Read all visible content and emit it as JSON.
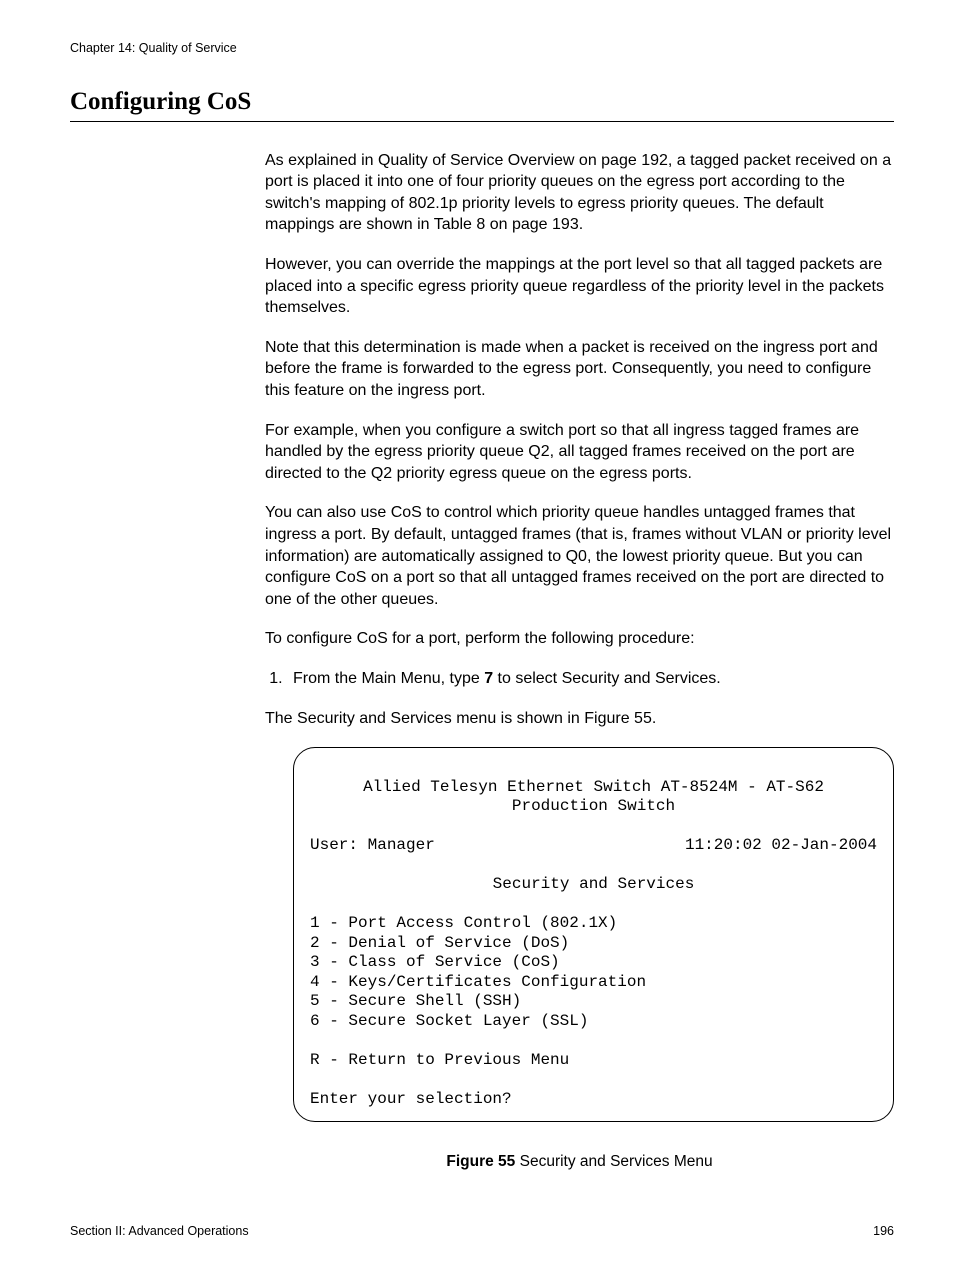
{
  "header": {
    "chapter": "Chapter 14: Quality of Service"
  },
  "title": "Configuring CoS",
  "paragraphs": {
    "p1": "As explained in Quality of Service Overview on page 192, a tagged packet received on a port is placed it into one of four priority queues on the egress port according to the switch's mapping of 802.1p priority levels to egress priority queues. The default mappings are shown in Table 8 on page 193.",
    "p2": "However, you can override the mappings at the port level so that all tagged packets are placed into a specific egress priority queue regardless of the priority level in the packets themselves.",
    "p3": "Note that this determination is made when a packet is received on the ingress port and before the frame is forwarded to the egress port. Consequently, you need to configure this feature on the ingress port.",
    "p4": "For example, when you configure a switch port so that all ingress tagged frames are handled by the egress priority queue Q2, all tagged frames received on the port are directed to the Q2 priority egress queue on the egress ports.",
    "p5": "You can also use CoS to control which priority queue handles untagged frames that ingress a port. By default, untagged frames (that is, frames without VLAN or priority level information) are automatically assigned to Q0, the lowest priority queue. But you can configure CoS on a port so that all untagged frames received on the port are directed to one of the other queues.",
    "p6": "To configure CoS for a port, perform the following procedure:"
  },
  "step1": {
    "prefix": "From the Main Menu, type ",
    "bold": "7",
    "suffix": " to select Security and Services.",
    "result": "The Security and Services menu is shown in Figure 55."
  },
  "terminal": {
    "line1": "Allied Telesyn Ethernet Switch AT-8524M - AT-S62",
    "line2": "Production Switch",
    "user_label": "User: Manager",
    "timestamp": "11:20:02 02-Jan-2004",
    "menu_title": "Security and Services",
    "items": {
      "i1": "1 - Port Access Control (802.1X)",
      "i2": "2 - Denial of Service (DoS)",
      "i3": "3 - Class of Service (CoS)",
      "i4": "4 - Keys/Certificates Configuration",
      "i5": "5 - Secure Shell (SSH)",
      "i6": "6 - Secure Socket Layer (SSL)",
      "ret": "R - Return to Previous Menu",
      "prompt": "Enter your selection?"
    }
  },
  "figure": {
    "num": "Figure 55",
    "caption": "  Security and Services Menu"
  },
  "footer": {
    "section": "Section II: Advanced Operations",
    "page": "196"
  }
}
